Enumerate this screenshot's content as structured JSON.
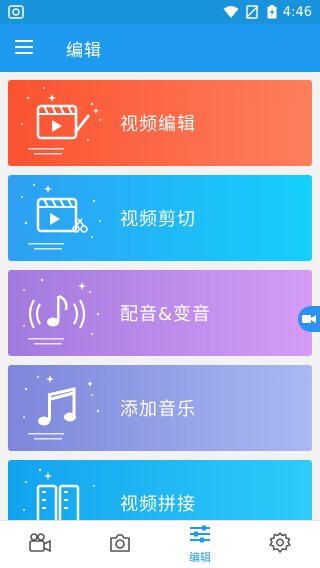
{
  "status_bar": {
    "time": "4:46",
    "icons": [
      "app-notification-icon",
      "wifi-icon",
      "no-sim-icon",
      "battery-charging-icon"
    ]
  },
  "app_bar": {
    "menu_icon": "hamburger-menu-icon",
    "title": "编辑"
  },
  "cards": [
    {
      "label": "视频编辑",
      "icon": "video-edit-icon"
    },
    {
      "label": "视频剪切",
      "icon": "video-cut-icon"
    },
    {
      "label": "配音&变音",
      "icon": "audio-dub-icon"
    },
    {
      "label": "添加音乐",
      "icon": "music-note-icon"
    },
    {
      "label": "视频拼接",
      "icon": "video-join-icon"
    }
  ],
  "floating_button": {
    "icon": "video-camera-icon"
  },
  "bottom_nav": {
    "items": [
      {
        "icon": "video-camera-icon",
        "label": ""
      },
      {
        "icon": "camera-icon",
        "label": ""
      },
      {
        "icon": "sliders-icon",
        "label": "编辑",
        "active": true
      },
      {
        "icon": "gear-icon",
        "label": ""
      }
    ]
  },
  "colors": {
    "status_bar": "#1893dc",
    "app_bar": "#1e9bf0",
    "card1": [
      "#fb5230",
      "#fe7f5c"
    ],
    "card2": [
      "#2e9ff2",
      "#13d0fc"
    ],
    "card3": [
      "#a17ade",
      "#d49cf6"
    ],
    "card4": [
      "#7d86db",
      "#aab8f3"
    ],
    "card5": [
      "#12a3ee",
      "#2ecbfa"
    ],
    "nav_active": "#1e9bf0",
    "nav_inactive": "#555555"
  }
}
